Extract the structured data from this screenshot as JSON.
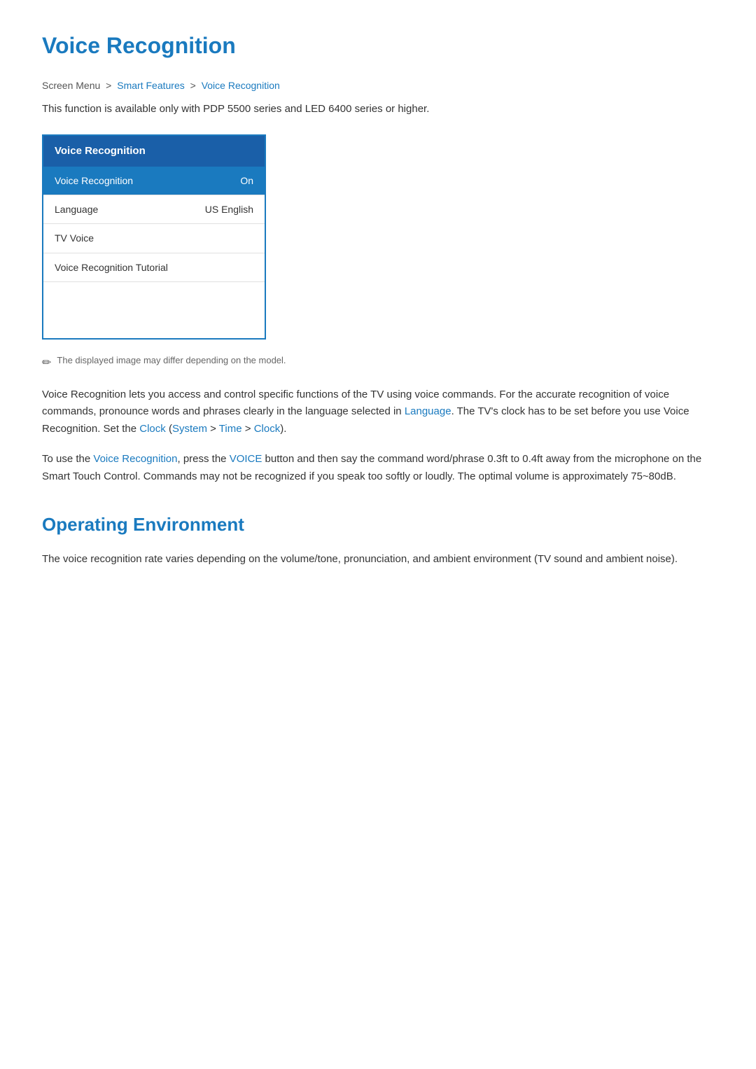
{
  "page": {
    "title": "Voice Recognition",
    "breadcrumb": {
      "plain": "Screen Menu",
      "sep1": ">",
      "link1": "Smart Features",
      "sep2": ">",
      "link2": "Voice Recognition"
    },
    "availability_note": "This function is available only with PDP 5500 series and LED 6400 series or higher.",
    "menu": {
      "title": "Voice Recognition",
      "items": [
        {
          "label": "Voice Recognition",
          "value": "On",
          "active": true
        },
        {
          "label": "Language",
          "value": "US English",
          "active": false
        },
        {
          "label": "TV Voice",
          "value": "",
          "active": false
        },
        {
          "label": "Voice Recognition Tutorial",
          "value": "",
          "active": false
        }
      ]
    },
    "image_note": "The displayed image may differ depending on the model.",
    "body_paragraph_1": "Voice Recognition lets you access and control specific functions of the TV using voice commands. For the accurate recognition of voice commands, pronounce words and phrases clearly in the language selected in Language. The TV's clock has to be set before you use Voice Recognition. Set the Clock (System > Time > Clock).",
    "body_paragraph_1_links": [
      "Language",
      "Clock",
      "System",
      "Time",
      "Clock"
    ],
    "body_paragraph_2": "To use the Voice Recognition, press the VOICE button and then say the command word/phrase 0.3ft to 0.4ft away from the microphone on the Smart Touch Control. Commands may not be recognized if you speak too softly or loudly. The optimal volume is approximately 75~80dB.",
    "body_paragraph_2_links": [
      "Voice Recognition",
      "VOICE"
    ],
    "section_operating": {
      "title": "Operating Environment",
      "body": "The voice recognition rate varies depending on the volume/tone, pronunciation, and ambient environment (TV sound and ambient noise)."
    }
  }
}
